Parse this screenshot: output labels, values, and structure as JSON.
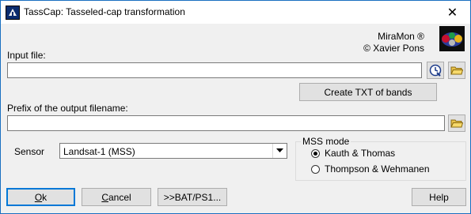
{
  "window": {
    "title": "TassCap: Tasseled-cap transformation",
    "close_glyph": "✕",
    "app_icon": "app-icon"
  },
  "brand": {
    "line1": "MiraMon ®",
    "line2": "© Xavier Pons",
    "logo": "miramon-logo"
  },
  "input_file": {
    "label": "Input file:",
    "value": "",
    "help_icon": "clock-help-icon",
    "browse_icon": "folder-icon"
  },
  "create_txt_button": "Create TXT of bands",
  "output_prefix": {
    "label": "Prefix of the output filename:",
    "value": "",
    "browse_icon": "folder-icon"
  },
  "sensor": {
    "label": "Sensor",
    "selected": "Landsat-1 (MSS)"
  },
  "mss_mode": {
    "title": "MSS mode",
    "options": [
      {
        "label": "Kauth & Thomas",
        "selected": true
      },
      {
        "label": "Thompson & Wehmanen",
        "selected": false
      }
    ]
  },
  "buttons": {
    "ok_first": "O",
    "ok_rest": "k",
    "cancel_first": "C",
    "cancel_rest": "ancel",
    "bat": ">>BAT/PS1...",
    "help": "Help"
  },
  "colors": {
    "accent": "#0078d7",
    "window_bg": "#f0f0f0",
    "button_bg": "#e1e1e1"
  }
}
